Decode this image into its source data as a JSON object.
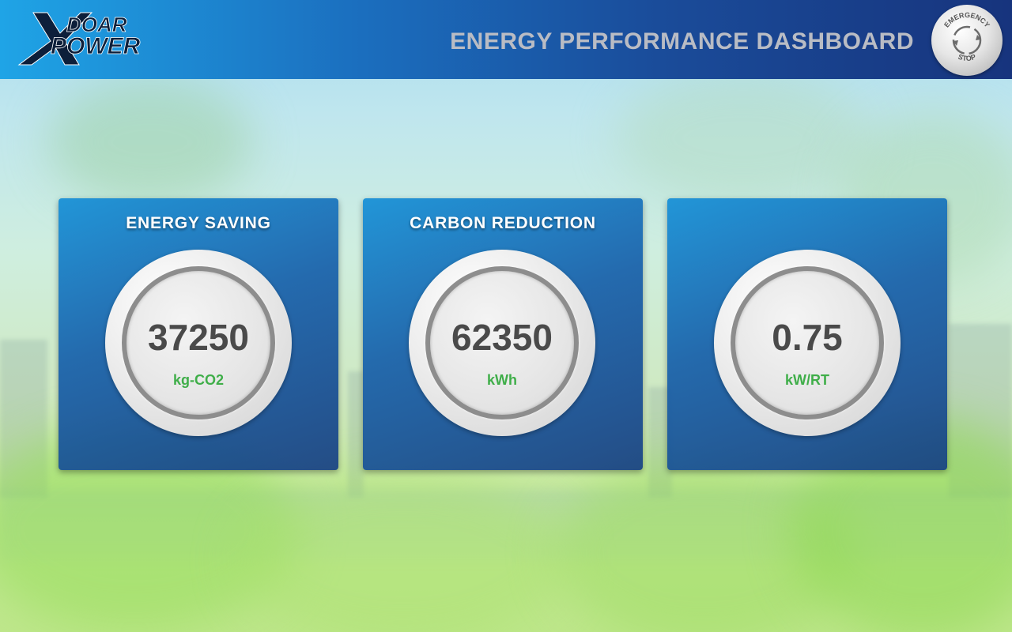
{
  "header": {
    "brand_top": "DOAR",
    "brand_bottom": "POWER",
    "brand_x": "X",
    "title": "ENERGY PERFORMANCE DASHBOARD",
    "emergency_top": "EMERGENCY",
    "emergency_bottom": "STOP"
  },
  "cards": [
    {
      "title": "ENERGY SAVING",
      "value": "37250",
      "unit": "kg-CO2"
    },
    {
      "title": "CARBON REDUCTION",
      "value": "62350",
      "unit": "kWh"
    },
    {
      "title": "",
      "value": "0.75",
      "unit": "kW/RT"
    }
  ],
  "colors": {
    "header_start": "#1fa4e6",
    "header_end": "#17347d",
    "unit_green": "#3fae49",
    "value_gray": "#4a4a4a"
  },
  "icons": {
    "emergency": "emergency-stop-icon"
  }
}
